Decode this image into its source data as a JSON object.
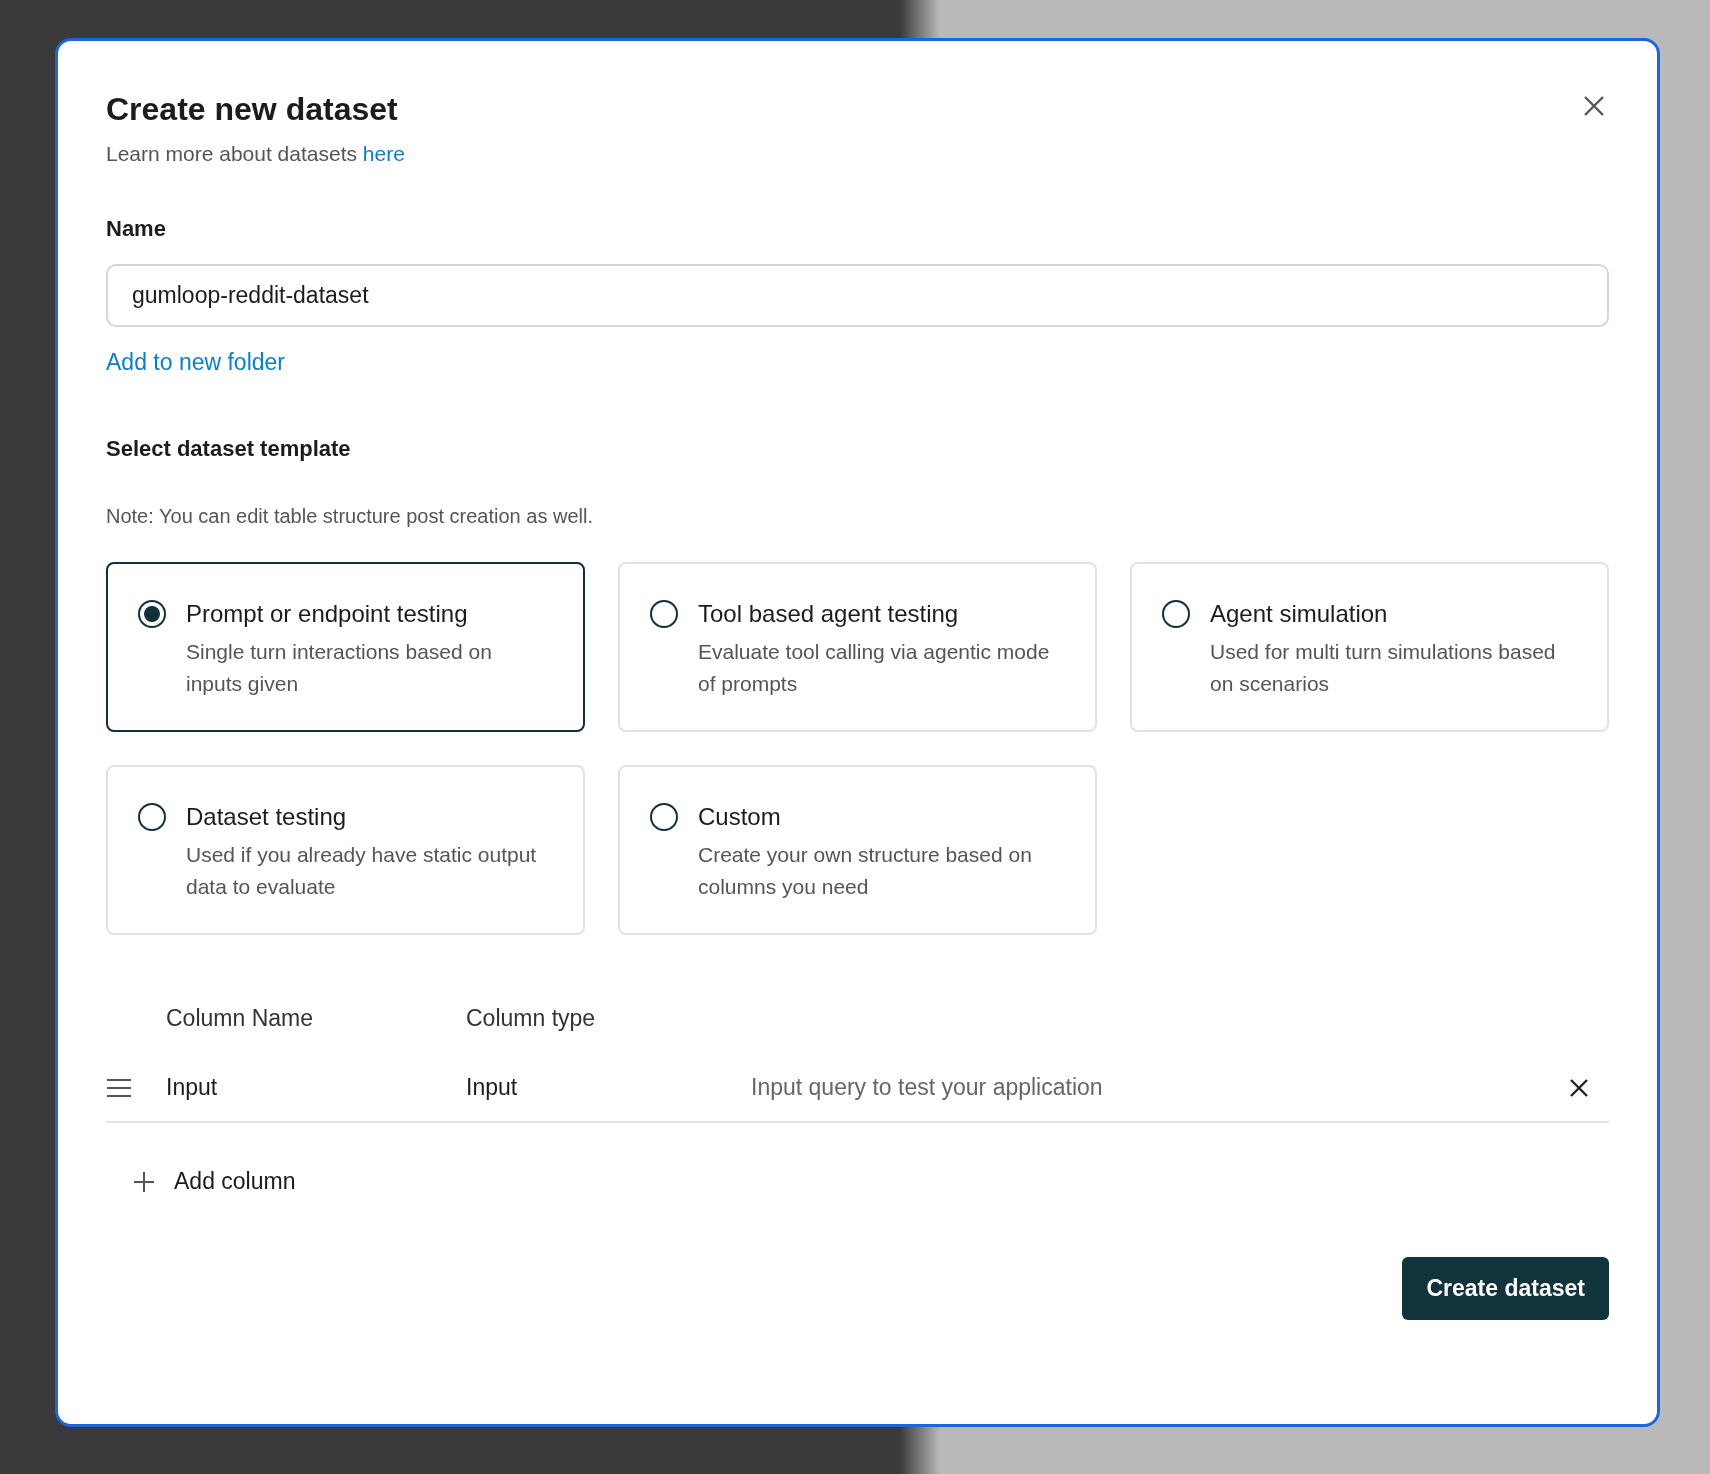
{
  "dialog": {
    "title": "Create new dataset",
    "subtitle": "Learn more about datasets ",
    "subtitle_link": "here"
  },
  "name_field": {
    "label": "Name",
    "value": "gumloop-reddit-dataset"
  },
  "folder_link": "Add to new folder",
  "template_section": {
    "title": "Select dataset template",
    "note": "Note: You can edit table structure post creation as well.",
    "templates": [
      {
        "title": "Prompt or endpoint testing",
        "description": "Single turn interactions based on inputs given",
        "selected": true
      },
      {
        "title": "Tool based agent testing",
        "description": "Evaluate tool calling via agentic mode of prompts",
        "selected": false
      },
      {
        "title": "Agent simulation",
        "description": "Used for multi turn simulations based on scenarios",
        "selected": false
      },
      {
        "title": "Dataset testing",
        "description": "Used if you already have static output data to evaluate",
        "selected": false
      },
      {
        "title": "Custom",
        "description": "Create your own structure based on columns you need",
        "selected": false
      }
    ]
  },
  "columns_table": {
    "headers": [
      "Column Name",
      "Column type"
    ],
    "rows": [
      {
        "name": "Input",
        "type": "Input",
        "description": "Input query to test your application"
      }
    ]
  },
  "add_column": "Add column",
  "submit_button": "Create dataset"
}
